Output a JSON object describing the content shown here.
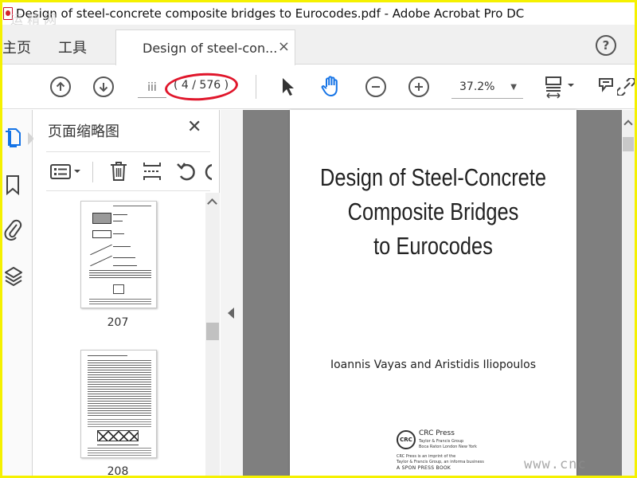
{
  "window": {
    "title": "Design of steel-concrete composite bridges to Eurocodes.pdf - Adobe Acrobat Pro DC"
  },
  "tabs": {
    "home_label": "主页",
    "tools_label": "工具",
    "doc_label": "Design of steel-con...",
    "close_glyph": "×",
    "help_glyph": "?"
  },
  "toolbar": {
    "page_input_value": "iii",
    "page_count": "( 4 / 576 )",
    "zoom": "37.2%",
    "zoom_caret": "▼"
  },
  "thumbnail_panel": {
    "title": "页面缩略图",
    "close_glyph": "✕",
    "pages": [
      {
        "number": "207"
      },
      {
        "number": "208"
      }
    ]
  },
  "document": {
    "title_lines": [
      "Design of Steel-Concrete",
      "Composite Bridges",
      "to Eurocodes"
    ],
    "authors": "Ioannis Vayas and Aristidis Iliopoulos",
    "publisher": {
      "logo_text": "CRC",
      "name": "CRC Press",
      "subtitle": "Taylor & Francis Group",
      "cities": "Boca Raton   London   New York",
      "imprint_line1": "CRC Press is an imprint of the",
      "imprint_line2": "Taylor & Francis Group, an informa business",
      "spon": "A SPON PRESS BOOK"
    }
  },
  "watermarks": {
    "top": "运 精 网",
    "bottom": "www.cnc"
  },
  "colors": {
    "frame_yellow": "#f5f100",
    "hand_tool_blue": "#1473e6",
    "annotation_red": "#e0162b",
    "doc_background": "#7f7f7f"
  },
  "icons": {
    "toolbar": [
      "previous-page-icon",
      "next-page-icon",
      "select-arrow-icon",
      "hand-tool-icon",
      "zoom-out-icon",
      "zoom-in-icon",
      "page-display-icon",
      "comment-icon",
      "link-icon"
    ],
    "nav": [
      "page-thumbnails-icon",
      "bookmark-icon",
      "attachment-icon",
      "layers-icon"
    ],
    "panel": [
      "thumbnail-options-icon",
      "delete-page-icon",
      "insert-page-icon",
      "rotate-page-icon"
    ]
  }
}
